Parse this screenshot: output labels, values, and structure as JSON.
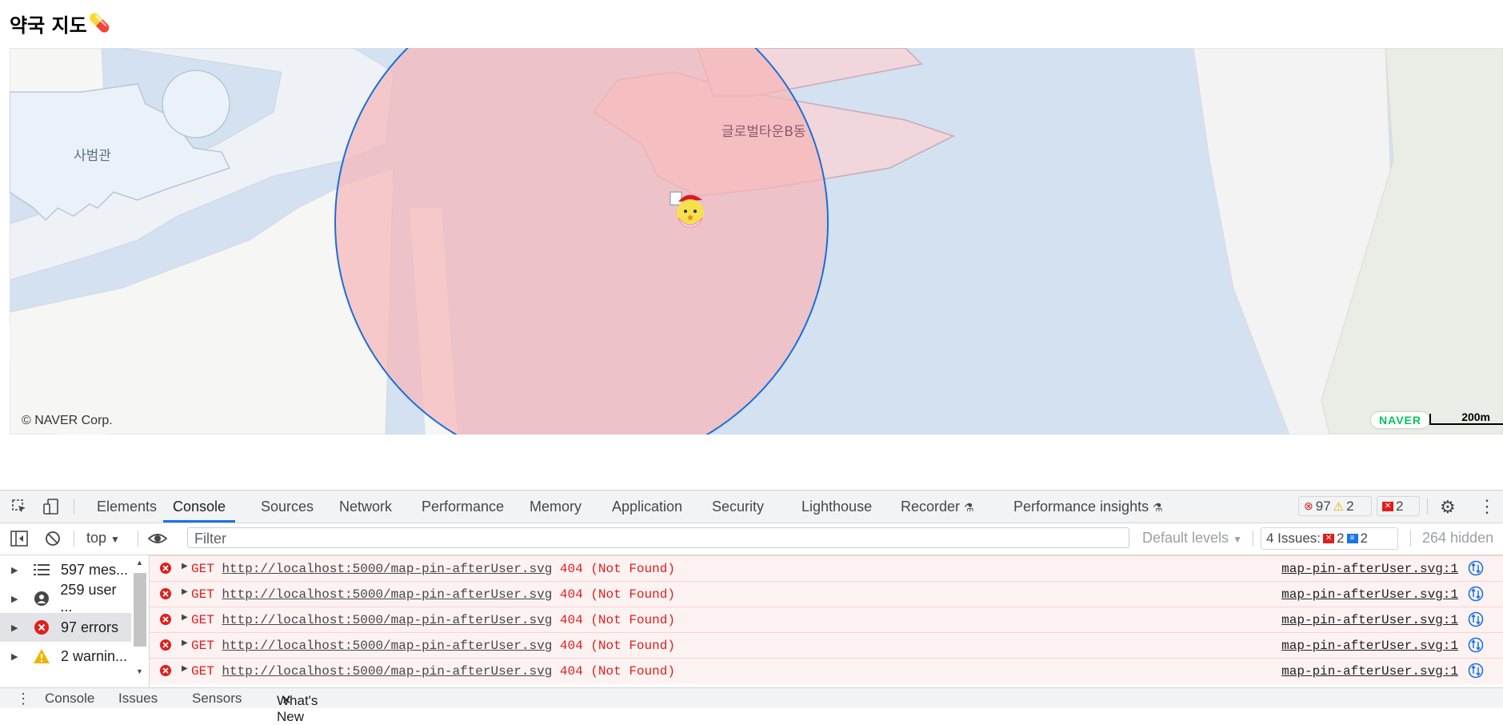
{
  "page": {
    "title": "약국 지도",
    "title_emoji": "💊"
  },
  "map": {
    "labels": {
      "building1": "사범관",
      "building2": "글로벌타운B동"
    },
    "copyright": "© NAVER Corp.",
    "logo": "NAVER",
    "scale": "200m",
    "colors": {
      "water": "#d3e1f1",
      "land": "#f6f6f4",
      "circle_fill": "#f7b5b9",
      "circle_stroke": "#1a6fd9"
    }
  },
  "devtools": {
    "tabs": [
      "Elements",
      "Console",
      "Sources",
      "Network",
      "Performance",
      "Memory",
      "Application",
      "Security",
      "Lighthouse",
      "Recorder",
      "Performance insights"
    ],
    "active_tab": "Console",
    "counts": {
      "errors": "97",
      "warnings": "2",
      "issues": "2"
    },
    "toolbar": {
      "context": "top",
      "filter_placeholder": "Filter",
      "levels": "Default levels",
      "issues_label": "4 Issues:",
      "issues_errors": "2",
      "issues_info": "2",
      "hidden": "264 hidden"
    },
    "sidebar": [
      {
        "label": "597 mes...",
        "icon": "list-icon"
      },
      {
        "label": "259 user ...",
        "icon": "user-icon"
      },
      {
        "label": "97 errors",
        "icon": "error-icon"
      },
      {
        "label": "2 warnin...",
        "icon": "warning-icon"
      }
    ],
    "messages": [
      {
        "method": "GET",
        "url": "http://localhost:5000/map-pin-afterUser.svg",
        "status": "404 (Not Found)",
        "source": "map-pin-afterUser.svg:1"
      },
      {
        "method": "GET",
        "url": "http://localhost:5000/map-pin-afterUser.svg",
        "status": "404 (Not Found)",
        "source": "map-pin-afterUser.svg:1"
      },
      {
        "method": "GET",
        "url": "http://localhost:5000/map-pin-afterUser.svg",
        "status": "404 (Not Found)",
        "source": "map-pin-afterUser.svg:1"
      },
      {
        "method": "GET",
        "url": "http://localhost:5000/map-pin-afterUser.svg",
        "status": "404 (Not Found)",
        "source": "map-pin-afterUser.svg:1"
      },
      {
        "method": "GET",
        "url": "http://localhost:5000/map-pin-afterUser.svg",
        "status": "404 (Not Found)",
        "source": "map-pin-afterUser.svg:1"
      }
    ],
    "drawer_tabs": [
      "Console",
      "Issues",
      "Sensors",
      "What's New"
    ]
  }
}
